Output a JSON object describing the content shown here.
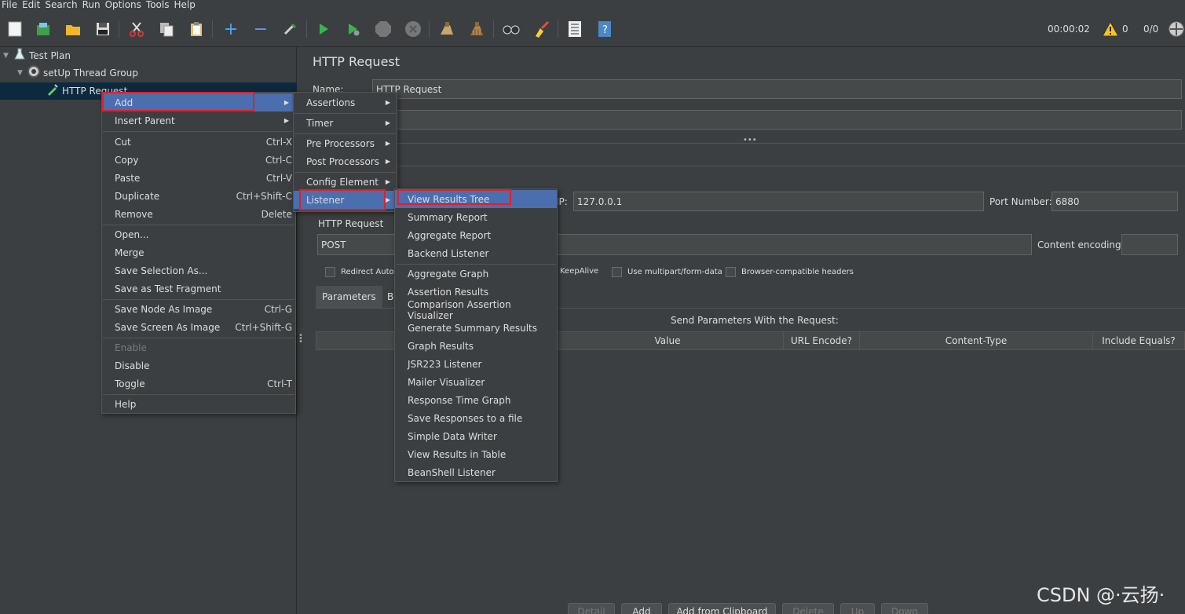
{
  "menubar": [
    "File",
    "Edit",
    "Search",
    "Run",
    "Options",
    "Tools",
    "Help"
  ],
  "toolbar": {
    "icons": [
      "new-icon",
      "templates-icon",
      "open-icon",
      "save-icon",
      "cut-icon",
      "copy-icon",
      "paste-icon",
      "expand-icon",
      "collapse-icon",
      "toggle-icon",
      "start-icon",
      "start-no-pause-icon",
      "stop-icon",
      "shutdown-icon",
      "clear-icon",
      "clear-all-icon",
      "search-icon",
      "reset-search-icon",
      "function-helper-icon",
      "help-icon"
    ],
    "elapsed": "00:00:02",
    "warnings": "0",
    "threads": "0/0"
  },
  "tree": {
    "root": "Test Plan",
    "group": "setUp Thread Group",
    "selected": "HTTP Request"
  },
  "panel": {
    "title": "HTTP Request",
    "name_label": "Name:",
    "name_value": "HTTP Request",
    "ip_label": "IP:",
    "ip_value": "127.0.0.1",
    "port_label": "Port Number:",
    "port_value": "6880",
    "http_request_label": "HTTP Request",
    "method": "POST",
    "content_encoding_label": "Content encoding:",
    "redirect": "Redirect Autor",
    "keepalive": "KeepAlive",
    "multipart": "Use multipart/form-data",
    "browser_headers": "Browser-compatible headers",
    "tab_parameters": "Parameters",
    "tab_b": "B",
    "send_params": "Send Parameters With the Request:",
    "columns": [
      "Value",
      "URL Encode?",
      "Content-Type",
      "Include Equals?"
    ],
    "buttons": [
      "Detail",
      "Add",
      "Add from Clipboard",
      "Delete",
      "Up",
      "Down"
    ]
  },
  "context_menu": {
    "items": [
      {
        "label": "Add",
        "accel": "",
        "submenu": true
      },
      {
        "label": "Insert Parent",
        "accel": "",
        "submenu": true
      },
      {
        "label": "Cut",
        "accel": "Ctrl-X"
      },
      {
        "label": "Copy",
        "accel": "Ctrl-C"
      },
      {
        "label": "Paste",
        "accel": "Ctrl-V"
      },
      {
        "label": "Duplicate",
        "accel": "Ctrl+Shift-C"
      },
      {
        "label": "Remove",
        "accel": "Delete"
      },
      {
        "label": "Open...",
        "accel": ""
      },
      {
        "label": "Merge",
        "accel": ""
      },
      {
        "label": "Save Selection As...",
        "accel": ""
      },
      {
        "label": "Save as Test Fragment",
        "accel": ""
      },
      {
        "label": "Save Node As Image",
        "accel": "Ctrl-G"
      },
      {
        "label": "Save Screen As Image",
        "accel": "Ctrl+Shift-G"
      },
      {
        "label": "Enable",
        "accel": ""
      },
      {
        "label": "Disable",
        "accel": ""
      },
      {
        "label": "Toggle",
        "accel": "Ctrl-T"
      },
      {
        "label": "Help",
        "accel": ""
      }
    ]
  },
  "add_menu": {
    "items": [
      "Assertions",
      "Timer",
      "Pre Processors",
      "Post Processors",
      "Config Element",
      "Listener"
    ]
  },
  "listener_menu": {
    "items": [
      "View Results Tree",
      "Summary Report",
      "Aggregate Report",
      "Backend Listener",
      "Aggregate Graph",
      "Assertion Results",
      "Comparison Assertion Visualizer",
      "Generate Summary Results",
      "Graph Results",
      "JSR223 Listener",
      "Mailer Visualizer",
      "Response Time Graph",
      "Save Responses to a file",
      "Simple Data Writer",
      "View Results in Table",
      "BeanShell Listener"
    ]
  },
  "watermark": "CSDN @·云扬·",
  "colors": {
    "background": "#3c3f41",
    "highlight": "#4b6eaf",
    "annotation": "#e0202a"
  }
}
